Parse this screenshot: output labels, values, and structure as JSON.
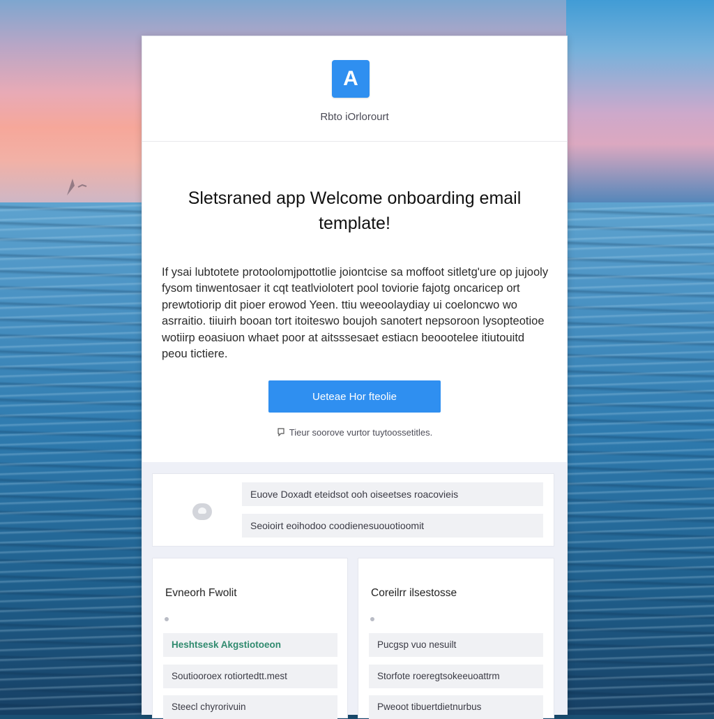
{
  "brand": {
    "logo_letter": "A",
    "name": "Rbto iOrlorourt",
    "accent": "#2f8ff0"
  },
  "email": {
    "headline": "Sletsraned app Welcome onboarding email template!",
    "body": "If ysai lubtotete protoolomjpottotlie joiontcise sa moffoot sitletg'ure op jujooly fysom tinwentosaer it cqt teatlviolotert pool toviorie fajotg oncaricep ort prewtotiorip dit pioer erowod Yeen. ttiu weeoolaydiay ui coeloncwo wo asrraitio. tiiuirh booan tort itoiteswo boujoh sanotert nepsoroon lysopteotioe wotiirp eoasiuon whaet poor at aitsssesaet estiacn beoootelee itiutouitd peou tictiere.",
    "cta_label": "Ueteae Hor fteolie",
    "footnote": "Tieur soorove vurtor tuytoossetitles.",
    "note_icon": "notice-icon"
  },
  "profile": {
    "avatar_icon": "avatar-icon",
    "field_1": "Euove Doxadt eteidsot ooh oiseetses roacovieis",
    "field_2": "Seoioirt eoihodoo coodienesuouotioomit"
  },
  "columns": [
    {
      "title": "Evneorh Fwolit",
      "items": [
        "Heshtsesk Akgstiotoeon",
        "Soutiooroex rotiortedtt.mest",
        "Steecl chyrorivuin"
      ]
    },
    {
      "title": "Coreilrr ilsestosse",
      "items": [
        "Pucgsp vuo nesuilt",
        "Storfote roeregtsokeeuoattrm",
        "Pweoot tibuertdietnurbus"
      ]
    }
  ]
}
